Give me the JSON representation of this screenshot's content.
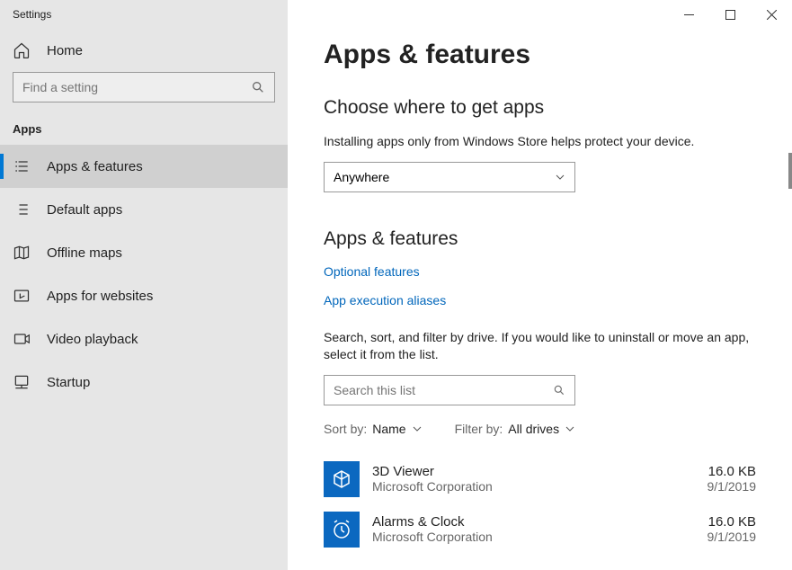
{
  "window": {
    "title": "Settings"
  },
  "sidebar": {
    "home_label": "Home",
    "search_placeholder": "Find a setting",
    "section_label": "Apps",
    "items": [
      {
        "label": "Apps & features",
        "active": true
      },
      {
        "label": "Default apps"
      },
      {
        "label": "Offline maps"
      },
      {
        "label": "Apps for websites"
      },
      {
        "label": "Video playback"
      },
      {
        "label": "Startup"
      }
    ]
  },
  "main": {
    "page_title": "Apps & features",
    "section1": {
      "heading": "Choose where to get apps",
      "help_text": "Installing apps only from Windows Store helps protect your device.",
      "dropdown_value": "Anywhere"
    },
    "section2": {
      "heading": "Apps & features",
      "link_optional": "Optional features",
      "link_aliases": "App execution aliases",
      "instructions": "Search, sort, and filter by drive. If you would like to uninstall or move an app, select it from the list.",
      "search_placeholder": "Search this list",
      "sort_label": "Sort by:",
      "sort_value": "Name",
      "filter_label": "Filter by:",
      "filter_value": "All drives",
      "apps": [
        {
          "name": "3D Viewer",
          "publisher": "Microsoft Corporation",
          "size": "16.0 KB",
          "date": "9/1/2019",
          "icon": "cube"
        },
        {
          "name": "Alarms & Clock",
          "publisher": "Microsoft Corporation",
          "size": "16.0 KB",
          "date": "9/1/2019",
          "icon": "clock"
        }
      ]
    }
  }
}
